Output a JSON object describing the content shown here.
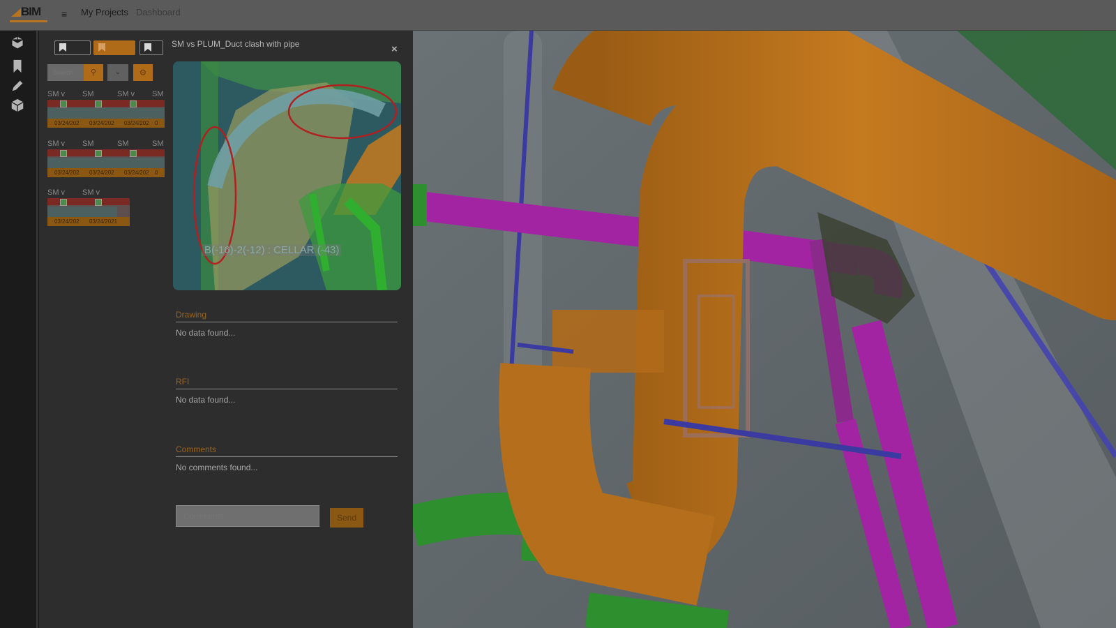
{
  "header": {
    "logo_text": "BIM",
    "my_projects": "My Projects",
    "dashboard": "Dashboard"
  },
  "rail": {
    "icons": [
      "cube-icon",
      "bookmark-icon",
      "pencil-icon",
      "box-icon"
    ]
  },
  "search": {
    "placeholder": "Search"
  },
  "issues": [
    {
      "title": "SM v",
      "date": "03/24/202"
    },
    {
      "title": "SM",
      "date": "03/24/202"
    },
    {
      "title": "SM v",
      "date": "03/24/202"
    },
    {
      "title": "SM",
      "date": "0"
    },
    {
      "title": "SM v",
      "date": "03/24/202"
    },
    {
      "title": "SM",
      "date": "03/24/202"
    },
    {
      "title": "SM",
      "date": "03/24/202"
    },
    {
      "title": "SM",
      "date": "0"
    },
    {
      "title": "SM v",
      "date": "03/24/202"
    },
    {
      "title": "SM v",
      "date": "03/24/2021"
    }
  ],
  "detail": {
    "title": "SM vs PLUM_Duct clash with pipe",
    "close": "×",
    "preview_caption": "B(-16)-2(-12) : CELLAR (-43)",
    "drawing": {
      "heading": "Drawing",
      "value": "No data found..."
    },
    "rfi": {
      "heading": "RFI",
      "value": "No data found..."
    },
    "comments": {
      "heading": "Comments",
      "value": "No comments found..."
    },
    "comment_placeholder": "Comments",
    "send_label": "Send"
  },
  "colors": {
    "accent": "#b06b18",
    "duct": "#c57a1f",
    "pipe": "#a324a3",
    "green_pipe": "#2d9a2d"
  }
}
